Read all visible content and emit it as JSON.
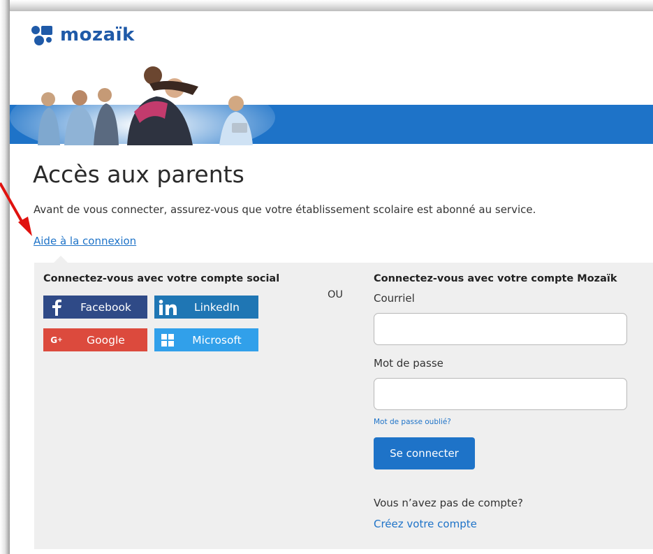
{
  "brand": {
    "name": "mozaïk",
    "color": "#1f5aa8"
  },
  "banner": {
    "band_color": "#1e73c8"
  },
  "page": {
    "title": "Accès aux parents",
    "intro": "Avant de vous connecter, assurez-vous que votre établissement scolaire est abonné au service.",
    "help_link": "Aide à la connexion"
  },
  "social": {
    "title": "Connectez-vous avec votre compte social",
    "buttons": [
      {
        "label": "Facebook",
        "icon": "facebook-icon",
        "color": "#2f4a87"
      },
      {
        "label": "LinkedIn",
        "icon": "linkedin-icon",
        "color": "#1f76b4"
      },
      {
        "label": "Google",
        "icon": "google-plus-icon",
        "color": "#dc4a3d"
      },
      {
        "label": "Microsoft",
        "icon": "windows-icon",
        "color": "#31a0ea"
      }
    ]
  },
  "separator": "OU",
  "mozaik_login": {
    "title": "Connectez-vous avec votre compte Mozaïk",
    "email_label": "Courriel",
    "email_value": "",
    "password_label": "Mot de passe",
    "password_value": "",
    "forgot": "Mot de passe oublié?",
    "submit": "Se connecter",
    "no_account": "Vous n’avez pas de compte?",
    "create_account": "Créez votre compte"
  },
  "annotation": {
    "arrow_color": "#e0120f"
  }
}
